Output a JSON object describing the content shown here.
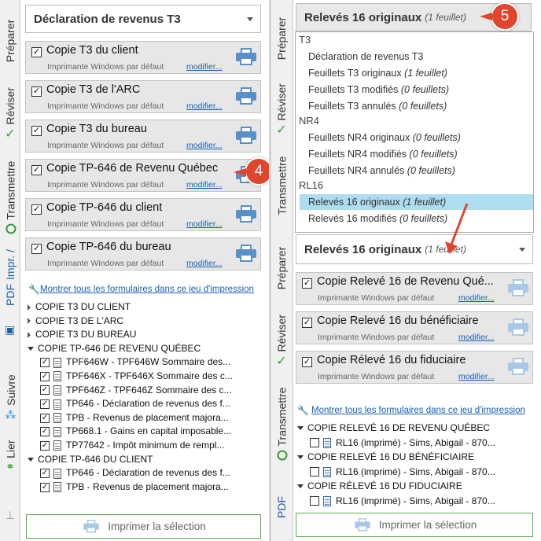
{
  "left": {
    "tabs": [
      "Préparer",
      "Réviser",
      "Transmettre",
      "PDF",
      "Impr. /",
      "Suivre",
      "Lier"
    ],
    "dropdown": "Déclaration de revenus T3",
    "copies": [
      {
        "title": "Copie T3 du client",
        "subtitle": "Imprimante Windows par défaut",
        "modify": "modifier..."
      },
      {
        "title": "Copie T3 de l'ARC",
        "subtitle": "Imprimante Windows par défaut",
        "modify": "modifier..."
      },
      {
        "title": "Copie T3 du bureau",
        "subtitle": "Imprimante Windows par défaut",
        "modify": "modifier..."
      },
      {
        "title": "Copie TP-646 de Revenu Québec",
        "subtitle": "Imprimante Windows par défaut",
        "modify": "modifier..."
      },
      {
        "title": "Copie TP-646 du client",
        "subtitle": "Imprimante Windows par défaut",
        "modify": "modifier..."
      },
      {
        "title": "Copie TP-646 du bureau",
        "subtitle": "Imprimante Windows par défaut",
        "modify": "modifier..."
      }
    ],
    "show_all": "Montrer tous les formulaires dans ce jeu d'impression",
    "tree": [
      {
        "kind": "group",
        "expanded": false,
        "label": "COPIE T3 DU CLIENT"
      },
      {
        "kind": "group",
        "expanded": false,
        "label": "COPIE T3 DE L'ARC"
      },
      {
        "kind": "group",
        "expanded": false,
        "label": "COPIE T3 DU BUREAU"
      },
      {
        "kind": "group",
        "expanded": true,
        "label": "COPIE TP-646 DE REVENU QUÉBEC"
      },
      {
        "kind": "item",
        "label": "TPF646W - TPF646W Sommaire des..."
      },
      {
        "kind": "item",
        "label": "TPF646X - TPF646X Sommaire des c..."
      },
      {
        "kind": "item",
        "label": "TPF646Z - TPF646Z Sommaire des c..."
      },
      {
        "kind": "item",
        "label": "TP646 - Déclaration de revenus des f..."
      },
      {
        "kind": "item",
        "label": "TPB - Revenus de placement majora..."
      },
      {
        "kind": "item",
        "label": "TP668.1 - Gains en capital imposable..."
      },
      {
        "kind": "item",
        "label": "TP77642 - Impôt minimum de rempl..."
      },
      {
        "kind": "group",
        "expanded": true,
        "label": "COPIE TP-646 DU CLIENT"
      },
      {
        "kind": "item",
        "label": "TP646 - Déclaration de revenus des f..."
      },
      {
        "kind": "item",
        "label": "TPB - Revenus de placement majora..."
      }
    ],
    "print_button": "Imprimer la sélection",
    "badge": "4"
  },
  "right": {
    "tabs": [
      "Préparer",
      "Réviser",
      "Transmettre",
      "Préparer",
      "Réviser",
      "Transmettre",
      "PDF"
    ],
    "dropdown_top": {
      "label": "Relevés 16 originaux",
      "note": "(1 feuillet)"
    },
    "badge": "5",
    "popup": [
      {
        "kind": "group",
        "label": "T3"
      },
      {
        "kind": "opt",
        "label": "Déclaration de revenus T3",
        "note": ""
      },
      {
        "kind": "opt",
        "label": "Feuillets T3 originaux",
        "note": "(1 feuillet)"
      },
      {
        "kind": "opt",
        "label": "Feuillets T3 modifiés",
        "note": "(0 feuillets)"
      },
      {
        "kind": "opt",
        "label": "Feuillets T3 annulés",
        "note": "(0 feuillets)"
      },
      {
        "kind": "group",
        "label": "NR4"
      },
      {
        "kind": "opt",
        "label": "Feuillets NR4 originaux",
        "note": "(0 feuillets)"
      },
      {
        "kind": "opt",
        "label": "Feuillets NR4 modifiés",
        "note": "(0 feuillets)"
      },
      {
        "kind": "opt",
        "label": "Feuillets NR4 annulés",
        "note": "(0 feuillets)"
      },
      {
        "kind": "group",
        "label": "RL16"
      },
      {
        "kind": "opt",
        "label": "Relevés 16 originaux",
        "note": "(1 feuillet)",
        "selected": true
      },
      {
        "kind": "opt",
        "label": "Relevés 16 modifiés",
        "note": "(0 feuillets)"
      }
    ],
    "dropdown": {
      "label": "Relevés 16 originaux",
      "note": "(1 feuillet)"
    },
    "copies": [
      {
        "title": "Copie Relevé 16 de Revenu Qué...",
        "subtitle": "Imprimante Windows par défaut",
        "modify": "modifier..."
      },
      {
        "title": "Copie Relevé 16 du bénéficiaire",
        "subtitle": "Imprimante Windows par défaut",
        "modify": "modifier..."
      },
      {
        "title": "Copie Rélevé 16 du fiduciaire",
        "subtitle": "Imprimante Windows par défaut",
        "modify": "modifier..."
      }
    ],
    "show_all": "Montrer tous les formulaires dans ce jeu d'impression",
    "tree": [
      {
        "kind": "group",
        "label": "COPIE RELEVÉ 16 DE REVENU QUÉBEC"
      },
      {
        "kind": "item",
        "label": "RL16 (imprimé) - Sims, Abigail - 870..."
      },
      {
        "kind": "group",
        "label": "COPIE RELEVÉ 16 DU BÉNÉFICIAIRE"
      },
      {
        "kind": "item",
        "label": "RL16 (imprimé) - Sims, Abigail - 870..."
      },
      {
        "kind": "group",
        "label": "COPIE RÉLEVÉ 16 DU FIDUCIAIRE"
      },
      {
        "kind": "item",
        "label": "RL16 (imprimé) - Sims, Abigail - 870..."
      }
    ],
    "print_button": "Imprimer la sélection"
  },
  "colors": {
    "accent_link": "#1a5fb4",
    "badge": "#e0452e",
    "selection": "#aedcf0",
    "print_border": "#59a84a"
  }
}
